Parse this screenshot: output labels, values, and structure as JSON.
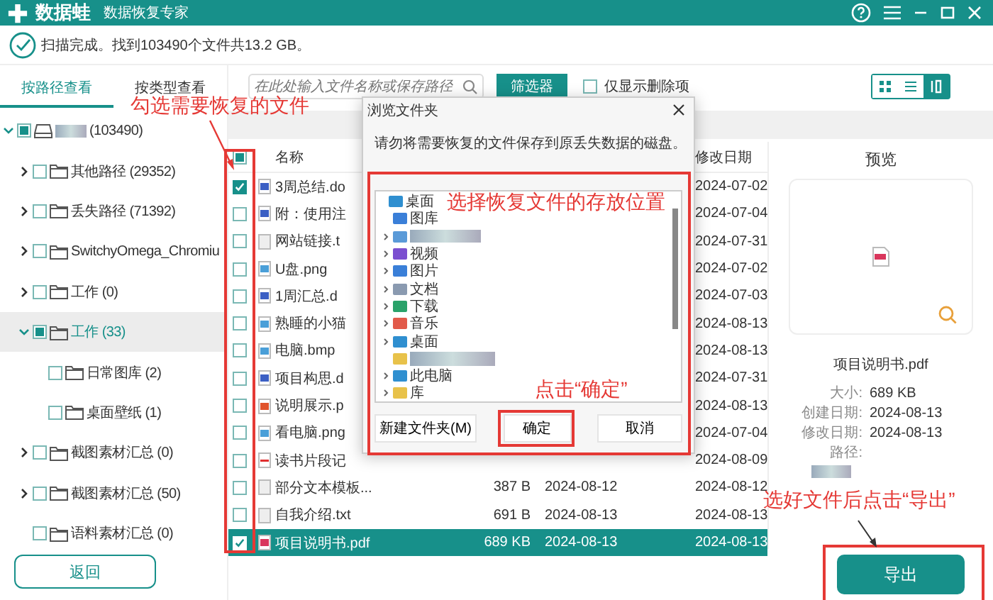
{
  "app": {
    "name": "数据蛙",
    "subtitle": "数据恢复专家"
  },
  "status": {
    "text": "扫描完成。找到103490个文件共13.2 GB。"
  },
  "view_tabs": [
    {
      "label": "按路径查看",
      "selected": true
    },
    {
      "label": "按类型查看",
      "selected": false
    }
  ],
  "tree": [
    {
      "label": "(103490)",
      "blurred": true,
      "kind": "drive",
      "checked": false,
      "partial": true,
      "expanded": true,
      "selected": false,
      "children": [
        {
          "label": "其他路径 (29352)",
          "kind": "folder",
          "checked": false,
          "partial": false,
          "expanded": false,
          "selected": false
        },
        {
          "label": "丢失路径 (71392)",
          "kind": "folder",
          "checked": false,
          "partial": false,
          "expanded": false,
          "selected": false
        },
        {
          "label": "SwitchyOmega_Chromiu",
          "kind": "folder",
          "checked": false,
          "partial": false,
          "expanded": false,
          "selected": false
        },
        {
          "label": "工作 (0)",
          "kind": "folder",
          "checked": false,
          "partial": false,
          "expanded": false,
          "selected": false
        },
        {
          "label": "工作 (33)",
          "kind": "folder",
          "checked": false,
          "partial": true,
          "expanded": true,
          "selected": true,
          "children": [
            {
              "label": "日常图库 (2)",
              "kind": "folder",
              "checked": false,
              "partial": false,
              "selected": false
            },
            {
              "label": "桌面壁纸 (1)",
              "kind": "folder",
              "checked": false,
              "partial": false,
              "selected": false
            }
          ]
        },
        {
          "label": "截图素材汇总 (0)",
          "kind": "folder",
          "checked": false,
          "partial": false,
          "expanded": false,
          "selected": false
        },
        {
          "label": "截图素材汇总 (50)",
          "kind": "folder",
          "checked": false,
          "partial": false,
          "expanded": false,
          "selected": false
        },
        {
          "label": "语料素材汇总 (0)",
          "kind": "folder",
          "checked": false,
          "partial": false,
          "selected": false
        }
      ]
    }
  ],
  "back_button": "返回",
  "search": {
    "placeholder": "在此处输入文件名称或保存路径"
  },
  "filter_button": "筛选器",
  "deleted_only": {
    "label": "仅显示删除项",
    "checked": false
  },
  "view_buttons": [
    {
      "kind": "grid",
      "selected": false
    },
    {
      "kind": "list",
      "selected": false
    },
    {
      "kind": "detail",
      "selected": true
    }
  ],
  "table": {
    "columns": [
      "名称",
      "修改日期"
    ],
    "header_checked": false,
    "header_partial": true,
    "rows": [
      {
        "kind": "doc",
        "name": "3周总结.do",
        "modified": "2024-07-02",
        "checked": true,
        "selected": false
      },
      {
        "kind": "doc",
        "name": "附：使用注",
        "modified": "2024-07-04",
        "checked": false,
        "selected": false
      },
      {
        "kind": "txt",
        "name": "网站链接.t",
        "modified": "2024-07-31",
        "checked": false,
        "selected": false
      },
      {
        "kind": "img",
        "name": "U盘.png",
        "modified": "2024-07-02",
        "checked": false,
        "selected": false
      },
      {
        "kind": "doc",
        "name": "1周汇总.d",
        "modified": "2024-07-03",
        "checked": false,
        "selected": false
      },
      {
        "kind": "img",
        "name": "熟睡的小猫",
        "modified": "2024-08-13",
        "checked": false,
        "selected": false
      },
      {
        "kind": "img",
        "name": "电脑.bmp",
        "modified": "2024-08-13",
        "checked": false,
        "selected": false
      },
      {
        "kind": "doc",
        "name": "项目构思.d",
        "modified": "2024-07-31",
        "checked": false,
        "selected": false
      },
      {
        "kind": "ppt",
        "name": "说明展示.p",
        "modified": "2024-08-13",
        "checked": false,
        "selected": false
      },
      {
        "kind": "img",
        "name": "看电脑.png",
        "modified": "2024-07-04",
        "checked": false,
        "selected": false
      },
      {
        "kind": "clip",
        "name": "读书片段记",
        "modified": "2024-08-09",
        "checked": false,
        "selected": false
      },
      {
        "kind": "txt",
        "name": "部分文本模板...",
        "size": "387 B",
        "created": "2024-08-12",
        "modified": "2024-08-12",
        "checked": false,
        "selected": false
      },
      {
        "kind": "txt",
        "name": "自我介绍.txt",
        "size": "691 B",
        "created": "2024-08-13",
        "modified": "2024-08-13",
        "checked": false,
        "selected": false
      },
      {
        "kind": "pdf",
        "name": "项目说明书.pdf",
        "size": "689 KB",
        "created": "2024-08-13",
        "modified": "2024-08-13",
        "checked": true,
        "selected": true
      }
    ]
  },
  "preview": {
    "title": "预览",
    "file_name": "项目说明书.pdf",
    "details": [
      {
        "label": "大小:",
        "value": "689 KB"
      },
      {
        "label": "创建日期:",
        "value": "2024-08-13"
      },
      {
        "label": "修改日期:",
        "value": "2024-08-13"
      },
      {
        "label": "路径:",
        "blurred": true
      }
    ]
  },
  "export_button": "导出",
  "dialog": {
    "title": "浏览文件夹",
    "message": "请勿将需要恢复的文件保存到原丢失数据的磁盘。",
    "tree": [
      {
        "label": "桌面",
        "kind": "desktop",
        "children": [
          {
            "label": "图库",
            "kind": "gallery"
          },
          {
            "blurred": true,
            "kind": "user",
            "expanded": false
          },
          {
            "label": "视频",
            "kind": "video",
            "expanded": false
          },
          {
            "label": "图片",
            "kind": "gallery",
            "expanded": false
          },
          {
            "label": "文档",
            "kind": "docs",
            "expanded": false
          },
          {
            "label": "下载",
            "kind": "download",
            "expanded": false
          },
          {
            "label": "音乐",
            "kind": "music",
            "expanded": false
          },
          {
            "label": "桌面",
            "kind": "desktop",
            "expanded": false
          },
          {
            "blurred": true,
            "kind": "folder"
          },
          {
            "label": "此电脑",
            "kind": "pc",
            "expanded": false
          },
          {
            "label": "库",
            "kind": "folder",
            "expanded": false
          }
        ]
      }
    ],
    "buttons": [
      {
        "label": "新建文件夹(M)"
      },
      {
        "label": "确定"
      },
      {
        "label": "取消"
      }
    ]
  },
  "annotations": [
    {
      "text": "勾选需要恢复的文件"
    },
    {
      "text": "选择恢复文件的存放位置"
    },
    {
      "text": "点击“确定”"
    },
    {
      "text": "选好文件后点击“导出”"
    }
  ]
}
